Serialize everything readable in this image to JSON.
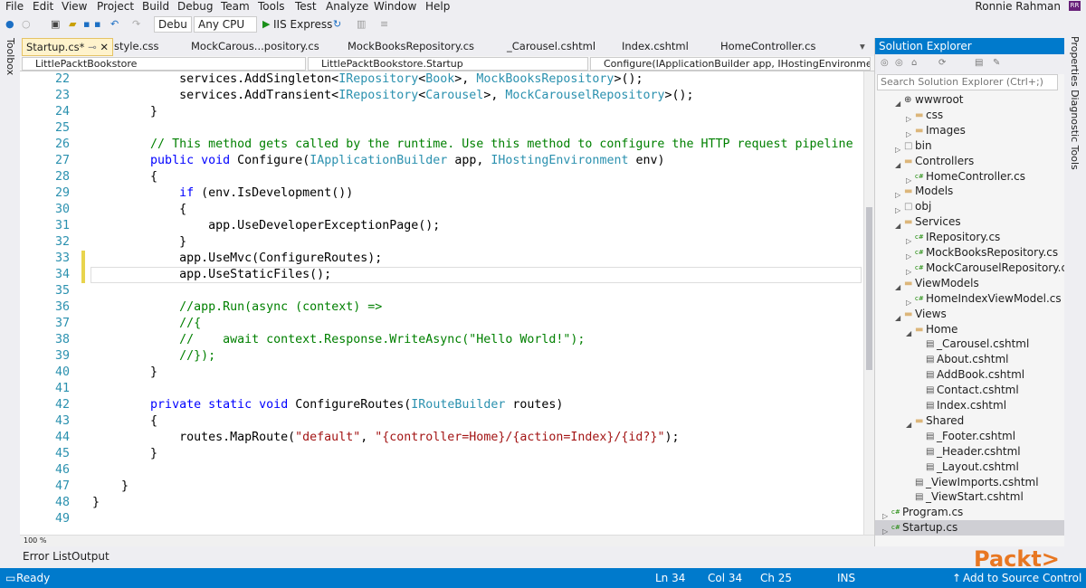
{
  "menu": [
    "File",
    "Edit",
    "View",
    "Project",
    "Build",
    "Debug",
    "Team",
    "Tools",
    "Test",
    "Analyze",
    "Window",
    "Help"
  ],
  "user": {
    "name": "Ronnie Rahman",
    "badge": "RR"
  },
  "toolbar": {
    "config": "Debu",
    "platform": "Any CPU",
    "run": "IIS Express"
  },
  "side_left": "Toolbox",
  "side_right": "Properties  Diagnostic Tools",
  "tabs": [
    "Startup.cs*",
    "style.css",
    "MockCarous...pository.cs",
    "MockBooksRepository.cs",
    "_Carousel.cshtml",
    "Index.cshtml",
    "HomeController.cs"
  ],
  "nav": {
    "project": "LittlePacktBookstore",
    "class": "LittlePacktBookstore.Startup",
    "member": "Configure(IApplicationBuilder app, IHostingEnvironmer"
  },
  "code": [
    {
      "n": "22",
      "t": "            services.AddSingleton<IRepository<Book>, MockBooksRepository>();"
    },
    {
      "n": "23",
      "t": "            services.AddTransient<IRepository<Carousel>, MockCarouselRepository>();"
    },
    {
      "n": "24",
      "t": "        }"
    },
    {
      "n": "25",
      "t": ""
    },
    {
      "n": "26",
      "t": "        // This method gets called by the runtime. Use this method to configure the HTTP request pipeline"
    },
    {
      "n": "27",
      "t": "        public void Configure(IApplicationBuilder app, IHostingEnvironment env)"
    },
    {
      "n": "28",
      "t": "        {"
    },
    {
      "n": "29",
      "t": "            if (env.IsDevelopment())"
    },
    {
      "n": "30",
      "t": "            {"
    },
    {
      "n": "31",
      "t": "                app.UseDeveloperExceptionPage();"
    },
    {
      "n": "32",
      "t": "            }"
    },
    {
      "n": "33",
      "t": "            app.UseMvc(ConfigureRoutes);"
    },
    {
      "n": "34",
      "t": "            app.UseStaticFiles();"
    },
    {
      "n": "35",
      "t": ""
    },
    {
      "n": "36",
      "t": "            //app.Run(async (context) =>"
    },
    {
      "n": "37",
      "t": "            //{"
    },
    {
      "n": "38",
      "t": "            //    await context.Response.WriteAsync(\"Hello World!\");"
    },
    {
      "n": "39",
      "t": "            //});"
    },
    {
      "n": "40",
      "t": "        }"
    },
    {
      "n": "41",
      "t": ""
    },
    {
      "n": "42",
      "t": "        private static void ConfigureRoutes(IRouteBuilder routes)"
    },
    {
      "n": "43",
      "t": "        {"
    },
    {
      "n": "44",
      "t": "            routes.MapRoute(\"default\", \"{controller=Home}/{action=Index}/{id?}\");"
    },
    {
      "n": "45",
      "t": "        }"
    },
    {
      "n": "46",
      "t": ""
    },
    {
      "n": "47",
      "t": "    }"
    },
    {
      "n": "48",
      "t": "}"
    },
    {
      "n": "49",
      "t": ""
    }
  ],
  "zoom": "100 %",
  "bottom_tabs": [
    "Error List",
    "Output"
  ],
  "solution_explorer": {
    "title": "Solution Explorer",
    "search_placeholder": "Search Solution Explorer (Ctrl+;)",
    "items": [
      {
        "label": "wwwroot",
        "depth": 0,
        "expanded": true,
        "icon": "globe-icon"
      },
      {
        "label": "css",
        "depth": 1,
        "expanded": false,
        "icon": "folder-icon"
      },
      {
        "label": "Images",
        "depth": 1,
        "expanded": false,
        "icon": "folder-icon"
      },
      {
        "label": "bin",
        "depth": 0,
        "expanded": false,
        "icon": "folder-outline-icon"
      },
      {
        "label": "Controllers",
        "depth": 0,
        "expanded": true,
        "icon": "folder-icon"
      },
      {
        "label": "HomeController.cs",
        "depth": 1,
        "expanded": false,
        "icon": "csharp-file-icon"
      },
      {
        "label": "Models",
        "depth": 0,
        "expanded": false,
        "icon": "folder-icon"
      },
      {
        "label": "obj",
        "depth": 0,
        "expanded": false,
        "icon": "folder-outline-icon"
      },
      {
        "label": "Services",
        "depth": 0,
        "expanded": true,
        "icon": "folder-icon"
      },
      {
        "label": "IRepository.cs",
        "depth": 1,
        "expanded": false,
        "icon": "csharp-file-icon"
      },
      {
        "label": "MockBooksRepository.cs",
        "depth": 1,
        "expanded": false,
        "icon": "csharp-file-icon"
      },
      {
        "label": "MockCarouselRepository.cs",
        "depth": 1,
        "expanded": false,
        "icon": "csharp-file-icon"
      },
      {
        "label": "ViewModels",
        "depth": 0,
        "expanded": true,
        "icon": "folder-icon"
      },
      {
        "label": "HomeIndexViewModel.cs",
        "depth": 1,
        "expanded": false,
        "icon": "csharp-file-icon"
      },
      {
        "label": "Views",
        "depth": 0,
        "expanded": true,
        "icon": "folder-icon"
      },
      {
        "label": "Home",
        "depth": 1,
        "expanded": true,
        "icon": "folder-icon"
      },
      {
        "label": "_Carousel.cshtml",
        "depth": 2,
        "expanded": null,
        "icon": "cshtml-file-icon"
      },
      {
        "label": "About.cshtml",
        "depth": 2,
        "expanded": null,
        "icon": "cshtml-file-icon"
      },
      {
        "label": "AddBook.cshtml",
        "depth": 2,
        "expanded": null,
        "icon": "cshtml-file-icon"
      },
      {
        "label": "Contact.cshtml",
        "depth": 2,
        "expanded": null,
        "icon": "cshtml-file-icon"
      },
      {
        "label": "Index.cshtml",
        "depth": 2,
        "expanded": null,
        "icon": "cshtml-file-icon"
      },
      {
        "label": "Shared",
        "depth": 1,
        "expanded": true,
        "icon": "folder-icon"
      },
      {
        "label": "_Footer.cshtml",
        "depth": 2,
        "expanded": null,
        "icon": "cshtml-file-icon"
      },
      {
        "label": "_Header.cshtml",
        "depth": 2,
        "expanded": null,
        "icon": "cshtml-file-icon"
      },
      {
        "label": "_Layout.cshtml",
        "depth": 2,
        "expanded": null,
        "icon": "cshtml-file-icon"
      },
      {
        "label": "_ViewImports.cshtml",
        "depth": 1,
        "expanded": null,
        "icon": "cshtml-file-icon"
      },
      {
        "label": "_ViewStart.cshtml",
        "depth": 1,
        "expanded": null,
        "icon": "cshtml-file-icon"
      },
      {
        "label": "Program.cs",
        "depth": -1,
        "expanded": false,
        "icon": "csharp-file-icon"
      },
      {
        "label": "Startup.cs",
        "depth": -1,
        "expanded": false,
        "icon": "csharp-file-icon",
        "selected": true
      }
    ]
  },
  "status": {
    "ready": "Ready",
    "ln": "Ln 34",
    "col": "Col 34",
    "ch": "Ch 25",
    "ins": "INS",
    "source_control": "Add to Source Control"
  },
  "logo": "Packt>"
}
